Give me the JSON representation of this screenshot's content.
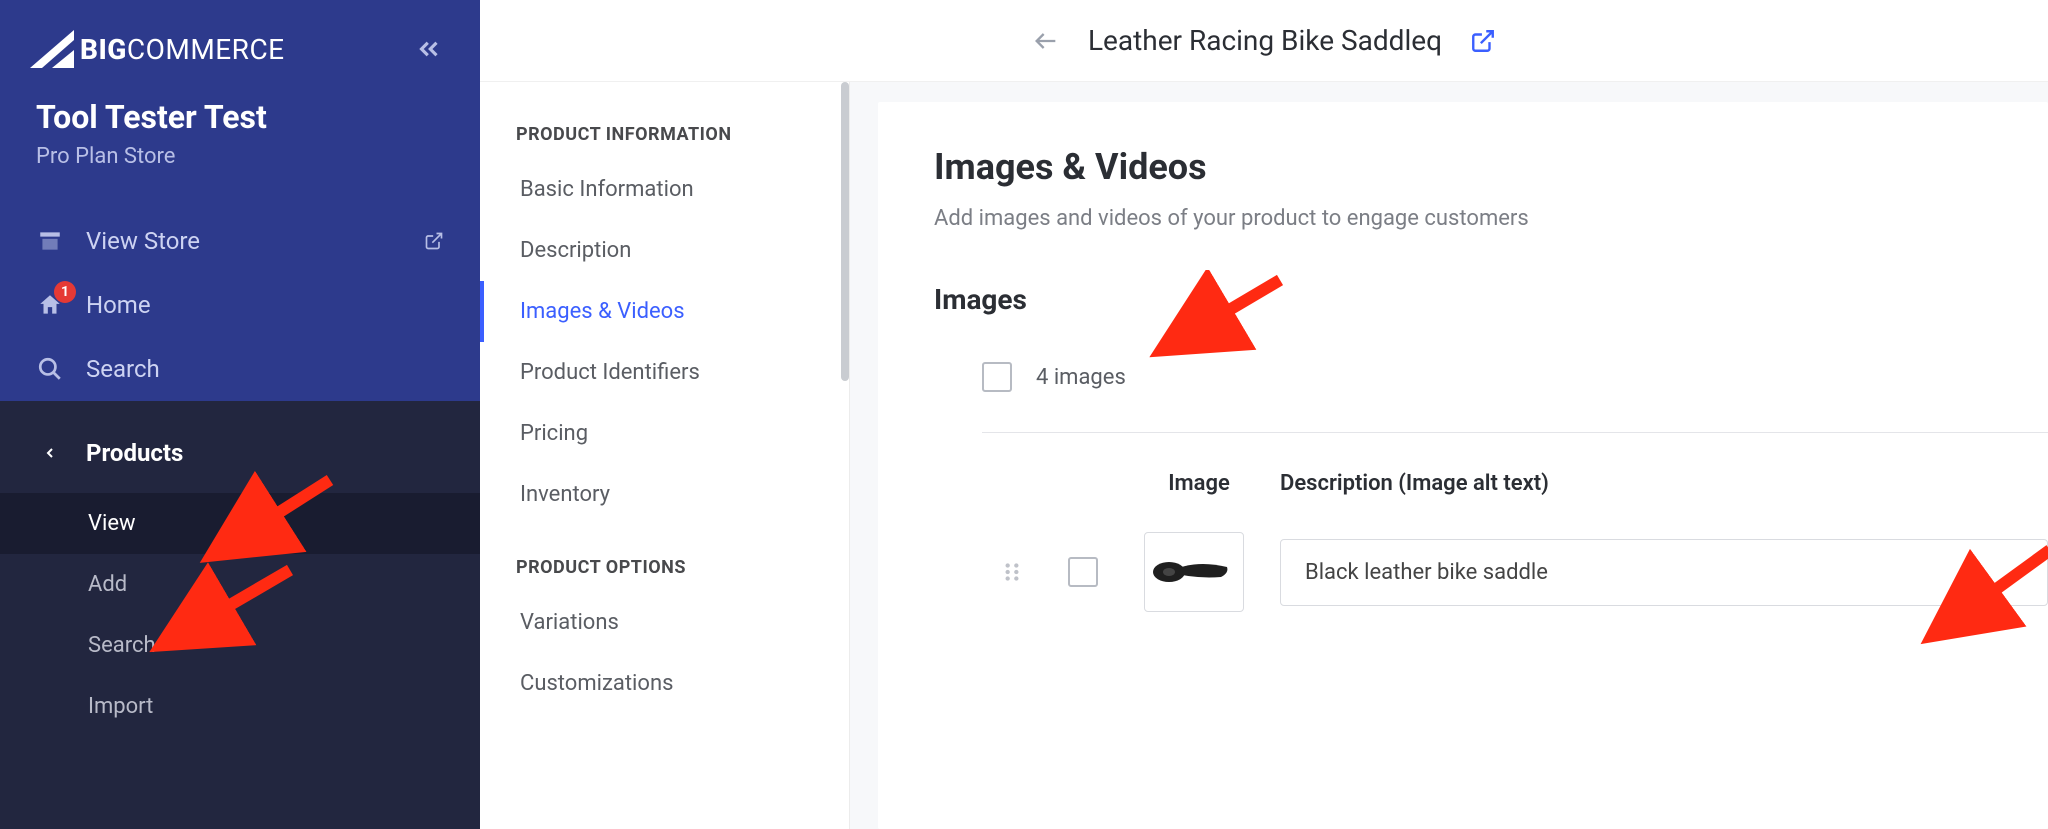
{
  "brand": {
    "big": "BIG",
    "rest": "COMMERCE"
  },
  "store": {
    "name": "Tool Tester Test",
    "plan": "Pro Plan Store"
  },
  "nav": {
    "view_store": "View Store",
    "home": "Home",
    "home_badge": "1",
    "search": "Search"
  },
  "section": {
    "title": "Products",
    "items": {
      "view": "View",
      "add": "Add",
      "search": "Search",
      "import": "Import"
    }
  },
  "topbar": {
    "title": "Leather Racing Bike Saddleq"
  },
  "secnav": {
    "group1_title": "PRODUCT INFORMATION",
    "group1": {
      "basic": "Basic Information",
      "description": "Description",
      "images": "Images & Videos",
      "identifiers": "Product Identifiers",
      "pricing": "Pricing",
      "inventory": "Inventory"
    },
    "group2_title": "PRODUCT OPTIONS",
    "group2": {
      "variations": "Variations",
      "customizations": "Customizations"
    }
  },
  "panel": {
    "heading": "Images & Videos",
    "description": "Add images and videos of your product to engage customers",
    "section_heading": "Images",
    "count": "4 images",
    "col_image": "Image",
    "col_alt": "Description (Image alt text)",
    "row1_alt": "Black leather bike saddle"
  }
}
